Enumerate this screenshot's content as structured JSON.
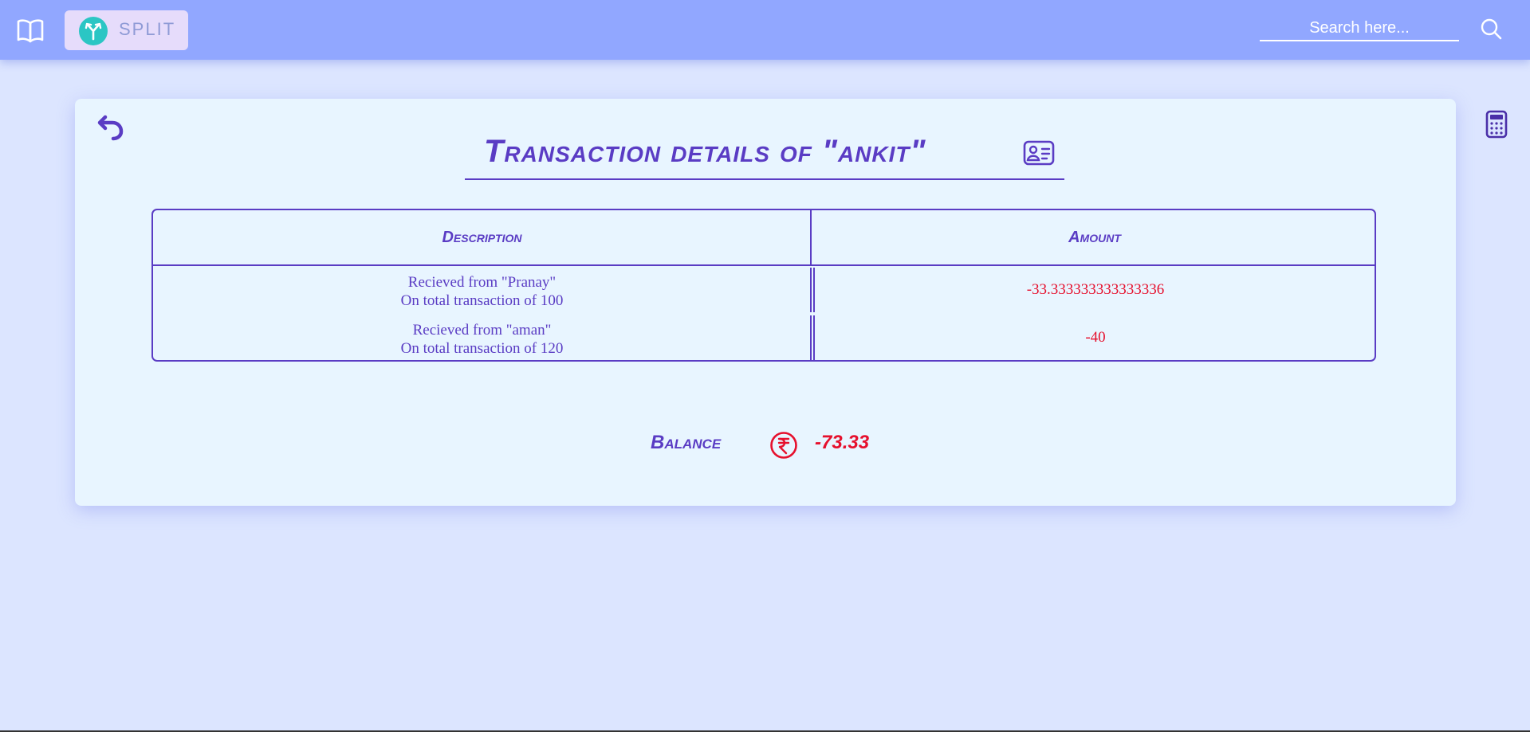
{
  "header": {
    "brand": "SPLIT",
    "search": {
      "placeholder": "Search here..."
    }
  },
  "page": {
    "title": "Transaction details of \"ankit\""
  },
  "table": {
    "columns": [
      "Description",
      "Amount"
    ],
    "rows": [
      {
        "line1": "Recieved from \"Pranay\"",
        "line2": "On total transaction of 100",
        "amount": "-33.333333333333336"
      },
      {
        "line1": "Recieved from \"aman\"",
        "line2": "On total transaction of 120",
        "amount": "-40"
      }
    ]
  },
  "balance": {
    "label": "Balance",
    "value": "-73.33"
  },
  "colors": {
    "accent": "#5a3cc4",
    "negative": "#e6102d",
    "header_bg": "#91a7ff",
    "page_bg": "#dce5ff",
    "card_bg": "#e8f5ff"
  },
  "icons": [
    "book-icon",
    "brand-logo-icon",
    "search-icon",
    "back-icon",
    "id-card-icon",
    "rupee-icon",
    "calculator-icon"
  ]
}
